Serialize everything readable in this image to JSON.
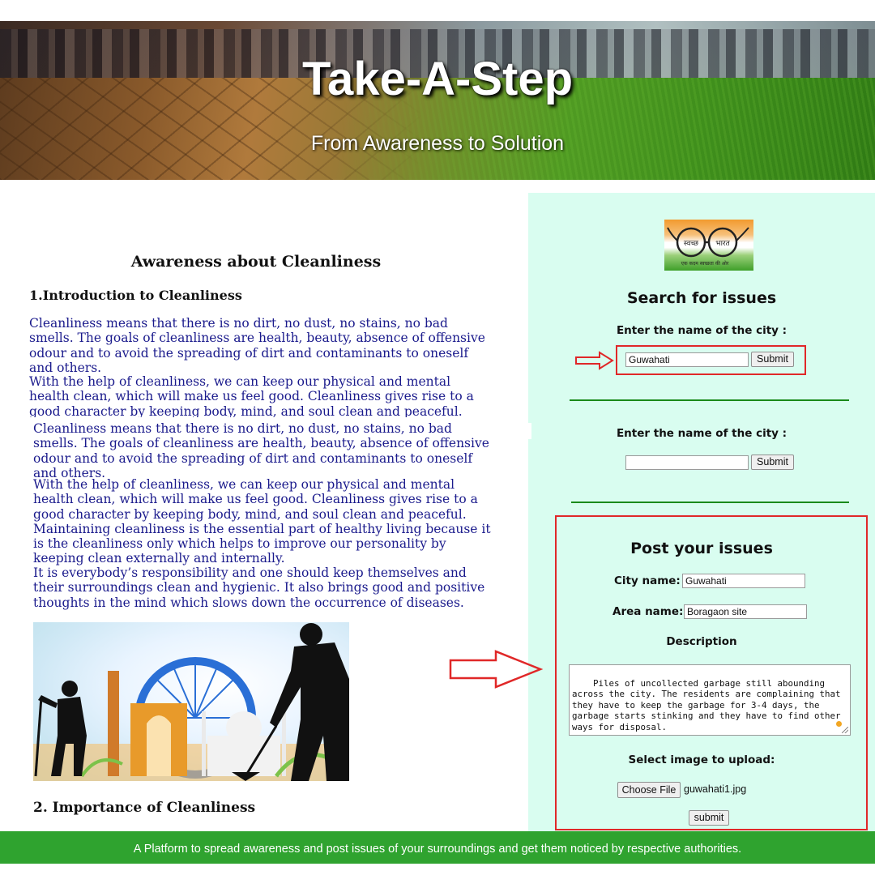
{
  "banner": {
    "title": "Take-A-Step",
    "subtitle": "From Awareness to Solution"
  },
  "article": {
    "heading": "Awareness about Cleanliness",
    "section1_title": "1.Introduction to Cleanliness",
    "para1": "Cleanliness means that there is no dirt, no dust, no stains, no bad smells. The goals of cleanliness are health, beauty, absence of offensive odour and to avoid the spreading of dirt and contaminants to oneself and others.",
    "para2": "With the help of cleanliness, we can keep our physical and mental health clean, which will make us feel good. Cleanliness gives rise to a good character by keeping body, mind, and soul clean and peaceful. Maintaining cleanliness is the essential part of",
    "para3": "Cleanliness means that there is no dirt, no dust, no stains, no bad smells. The goals of cleanliness are health, beauty, absence of offensive odour and to avoid the spreading of dirt and contaminants to oneself and others.",
    "para4": "With the help of cleanliness, we can keep our physical and mental health clean, which will make us feel good. Cleanliness gives rise to a good character by keeping body, mind, and soul clean and peaceful. Maintaining cleanliness is the essential part of healthy living because it is the cleanliness only which helps to improve our personality by keeping clean externally and internally.",
    "para5": "It is everybody’s responsibility and one should keep themselves and their surroundings clean and hygienic. It also brings good and positive thoughts in the mind which slows down the occurrence of diseases.",
    "section2_title": "2. Importance of Cleanliness"
  },
  "logo": {
    "left_text": "स्वच्छ",
    "right_text": "भारत",
    "tagline": "एक कदम स्वच्छता की ओर"
  },
  "search": {
    "title": "Search for issues",
    "city_label": "Enter the name of the city :",
    "city_value": "Guwahati",
    "submit_label": "Submit",
    "city_label_2": "Enter the name of the city :",
    "city_value_2": "",
    "submit_label_2": "Submit"
  },
  "post": {
    "title": "Post your issues",
    "city_label": "City name:",
    "city_value": "Guwahati",
    "area_label": "Area name:",
    "area_value": "Boragaon site",
    "description_label": "Description",
    "description_value": "Piles of uncollected garbage still abounding across the city. The residents are complaining that they have to keep the garbage for 3-4 days, the garbage starts stinking and they have to find other ways for disposal.",
    "image_label": "Select image to upload:",
    "choose_file_label": "Choose File",
    "file_name": "guwahati1.jpg",
    "submit_label": "submit"
  },
  "footer": {
    "text": "A Platform to spread awareness and post issues of your surroundings and get them noticed by respective authorities."
  },
  "colors": {
    "panel_bg": "#d9fdf0",
    "footer_bg": "#2fa32f",
    "article_text": "#1a1a8c",
    "highlight_red": "#e02828",
    "rule_green": "#1a8a1a"
  }
}
